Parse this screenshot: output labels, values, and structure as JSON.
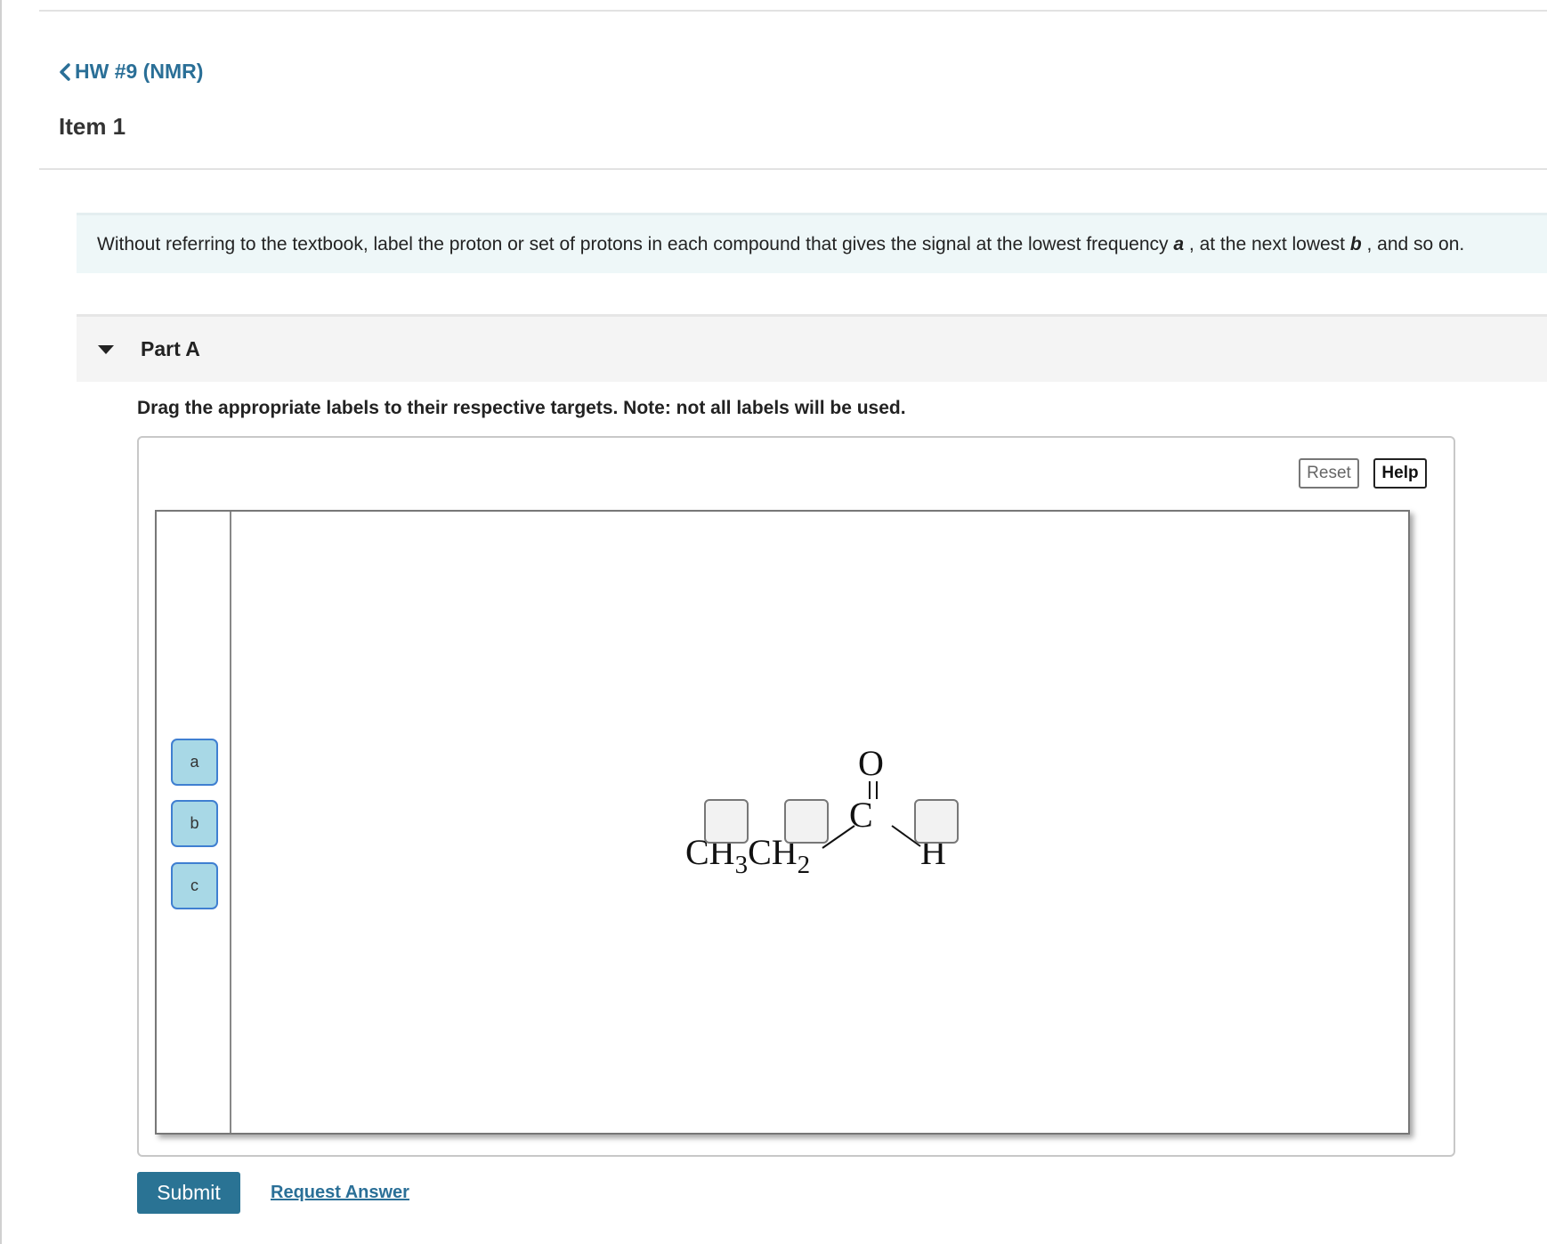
{
  "nav": {
    "back_label": "HW #9 (NMR)"
  },
  "item": {
    "title": "Item 1"
  },
  "instructions": {
    "text_1": "Without referring to the textbook, label the proton or set of protons in each compound that gives the signal at the lowest frequency ",
    "label_a": "a",
    "text_2": " , at the next lowest ",
    "label_b": "b",
    "text_3": " , and so on."
  },
  "part": {
    "title": "Part A",
    "expanded": true
  },
  "drag_instructions": "Drag the appropriate labels to their respective targets. Note: not all labels will be used.",
  "widget": {
    "reset_label": "Reset",
    "help_label": "Help"
  },
  "labels": [
    "a",
    "b",
    "c"
  ],
  "molecule": {
    "ch3": "CH",
    "sub3": "3",
    "ch2": "CH",
    "sub2": "2",
    "oxygen": "O",
    "carbon": "C",
    "hydrogen": "H",
    "drop_targets": [
      "CH3",
      "CH2",
      "H"
    ]
  },
  "actions": {
    "submit_label": "Submit",
    "request_answer_label": "Request Answer"
  },
  "colors": {
    "accent": "#2a7394",
    "link": "#2a6f97",
    "label_bg": "#a8d8e6",
    "label_border": "#3f7fd1"
  }
}
